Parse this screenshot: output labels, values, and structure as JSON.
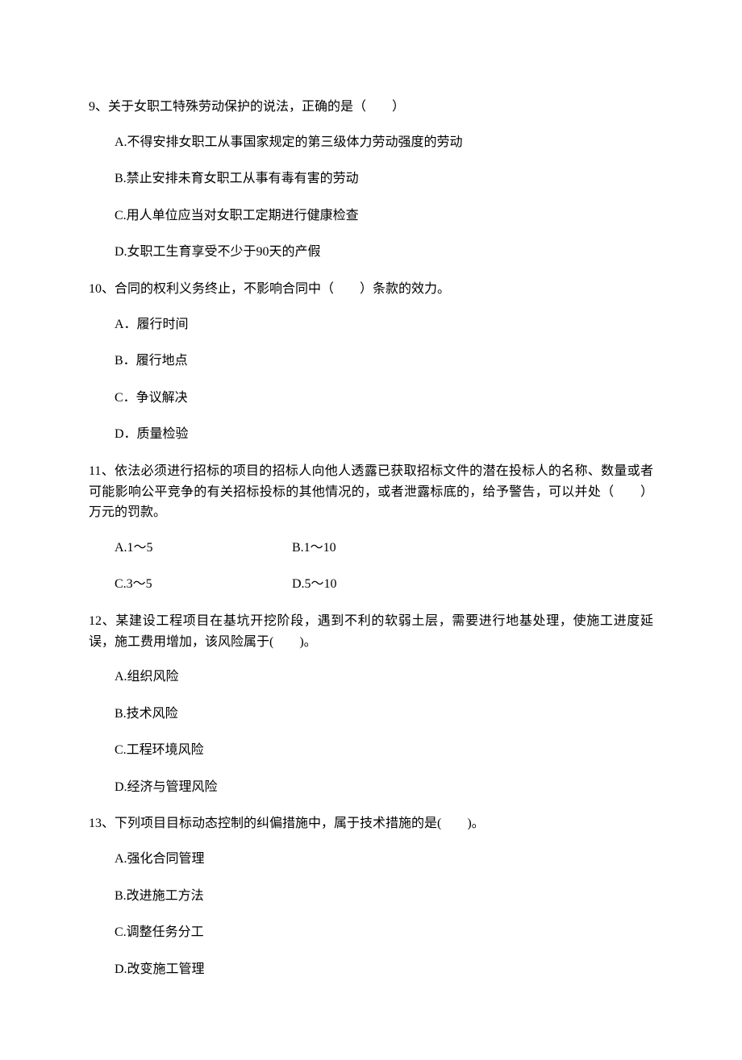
{
  "questions": [
    {
      "number": "9、",
      "text": "关于女职工特殊劳动保护的说法，正确的是（　　）",
      "options": [
        "A.不得安排女职工从事国家规定的第三级体力劳动强度的劳动",
        "B.禁止安排未育女职工从事有毒有害的劳动",
        "C.用人单位应当对女职工定期进行健康检查",
        "D.女职工生育享受不少于90天的产假"
      ]
    },
    {
      "number": "10、",
      "text": "合同的权利义务终止，不影响合同中（　　）条款的效力。",
      "options": [
        "A．履行时间",
        "B．履行地点",
        "C．争议解决",
        "D．质量检验"
      ]
    },
    {
      "number": "11、",
      "text": "依法必须进行招标的项目的招标人向他人透露已获取招标文件的潜在投标人的名称、数量或者可能影响公平竞争的有关招标投标的其他情况的，或者泄露标底的，给予警告，可以并处（　　）万元的罚款。",
      "optionsGrid": [
        [
          "A.1～5",
          "B.1～10"
        ],
        [
          "C.3～5",
          "D.5～10"
        ]
      ]
    },
    {
      "number": "12、",
      "text": "某建设工程项目在基坑开挖阶段，遇到不利的软弱土层，需要进行地基处理，使施工进度延误，施工费用增加，该风险属于(　　)。",
      "options": [
        "A.组织风险",
        "B.技术风险",
        "C.工程环境风险",
        "D.经济与管理风险"
      ]
    },
    {
      "number": "13、",
      "text": "下列项目目标动态控制的纠偏措施中，属于技术措施的是(　　)。",
      "options": [
        "A.强化合同管理",
        "B.改进施工方法",
        "C.调整任务分工",
        "D.改变施工管理"
      ]
    }
  ]
}
